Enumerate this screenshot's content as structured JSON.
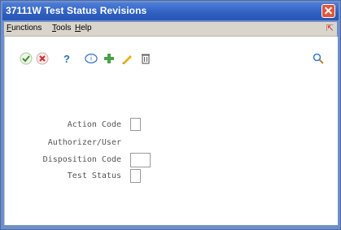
{
  "window": {
    "title": "37111W  Test Status Revisions"
  },
  "menu": {
    "items": [
      "Functions",
      "Tools",
      "Help"
    ]
  },
  "toolbar": {
    "icons": [
      "check-icon",
      "cancel-icon",
      "help-icon",
      "info-icon",
      "add-icon",
      "edit-icon",
      "delete-icon",
      "search-icon"
    ],
    "help_glyph": "?"
  },
  "form": {
    "fields": [
      {
        "label": "Action Code",
        "value": ""
      },
      {
        "label": "Authorizer/User",
        "value": ""
      },
      {
        "label": "Disposition Code",
        "value": ""
      },
      {
        "label": "Test Status",
        "value": ""
      }
    ]
  }
}
